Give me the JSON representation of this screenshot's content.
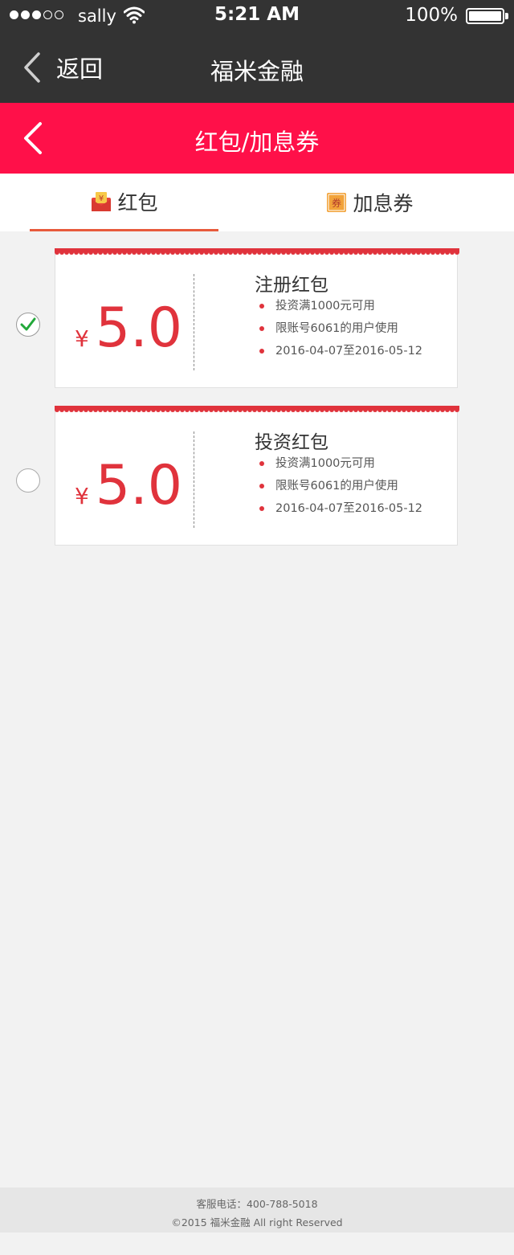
{
  "status_bar": {
    "signal_dots_filled": 3,
    "signal_dots_total": 5,
    "carrier": "sally",
    "wifi_icon": "wifi-icon",
    "time": "5:21 AM",
    "battery_percent": "100%",
    "battery_level": 1.0
  },
  "nav": {
    "back_label": "返回",
    "title": "福米金融"
  },
  "header": {
    "title": "红包/加息券"
  },
  "tabs": [
    {
      "label": "红包",
      "icon": "red-envelope-icon",
      "active": true
    },
    {
      "label": "加息券",
      "icon": "coupon-icon",
      "active": false
    }
  ],
  "coupons": [
    {
      "selected": true,
      "currency": "¥",
      "amount": "5.0",
      "title": "注册红包",
      "rules": [
        "投资满1000元可用",
        "限账号6061的用户使用",
        "2016-04-07至2016-05-12"
      ]
    },
    {
      "selected": false,
      "currency": "¥",
      "amount": "5.0",
      "title": "投资红包",
      "rules": [
        "投资满1000元可用",
        "限账号6061的用户使用",
        "2016-04-07至2016-05-12"
      ]
    }
  ],
  "footer": {
    "phone_line": "客服电话：400-788-5018",
    "copyright": "©2015  福米金融  All right Reserved"
  },
  "colors": {
    "topbar": "#333333",
    "header_red": "#ff1049",
    "amount_red": "#e0333c",
    "tab_underline": "#e85a3c",
    "check_green": "#22a83a"
  }
}
